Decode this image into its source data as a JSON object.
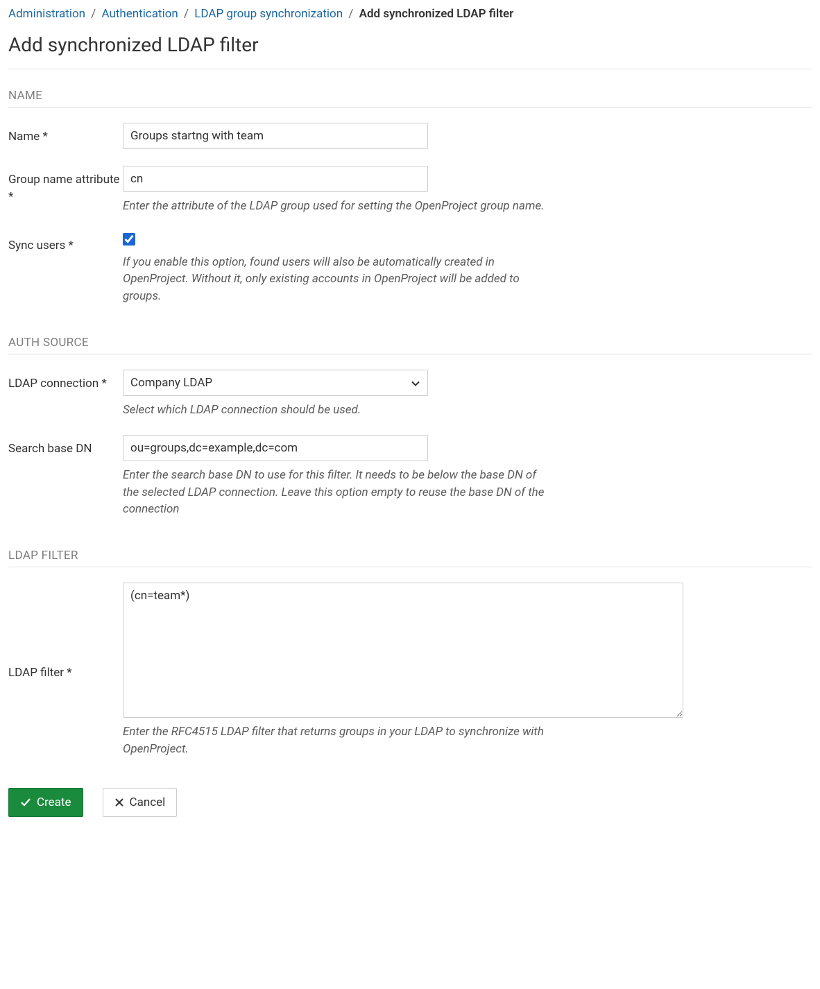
{
  "breadcrumb": {
    "items": [
      {
        "label": "Administration"
      },
      {
        "label": "Authentication"
      },
      {
        "label": "LDAP group synchronization"
      }
    ],
    "current": "Add synchronized LDAP filter"
  },
  "page_title": "Add synchronized LDAP filter",
  "sections": {
    "name": {
      "header": "Name",
      "fields": {
        "name": {
          "label": "Name *",
          "value": "Groups startng with team"
        },
        "group_name_attribute": {
          "label": "Group name attribute *",
          "value": "cn",
          "help": "Enter the attribute of the LDAP group used for setting the OpenProject group name."
        },
        "sync_users": {
          "label": "Sync users *",
          "checked": true,
          "help": "If you enable this option, found users will also be automatically created in OpenProject. Without it, only existing accounts in OpenProject will be added to groups."
        }
      }
    },
    "auth_source": {
      "header": "Auth source",
      "fields": {
        "ldap_connection": {
          "label": "LDAP connection *",
          "value": "Company LDAP",
          "help": "Select which LDAP connection should be used."
        },
        "search_base_dn": {
          "label": "Search base DN",
          "value": "ou=groups,dc=example,dc=com",
          "help": "Enter the search base DN to use for this filter. It needs to be below the base DN of the selected LDAP connection. Leave this option empty to reuse the base DN of the connection"
        }
      }
    },
    "ldap_filter": {
      "header": "LDAP filter",
      "fields": {
        "ldap_filter": {
          "label": "LDAP filter *",
          "value": "(cn=team*)",
          "help": "Enter the RFC4515 LDAP filter that returns groups in your LDAP to synchronize with OpenProject."
        }
      }
    }
  },
  "buttons": {
    "create": "Create",
    "cancel": "Cancel"
  }
}
